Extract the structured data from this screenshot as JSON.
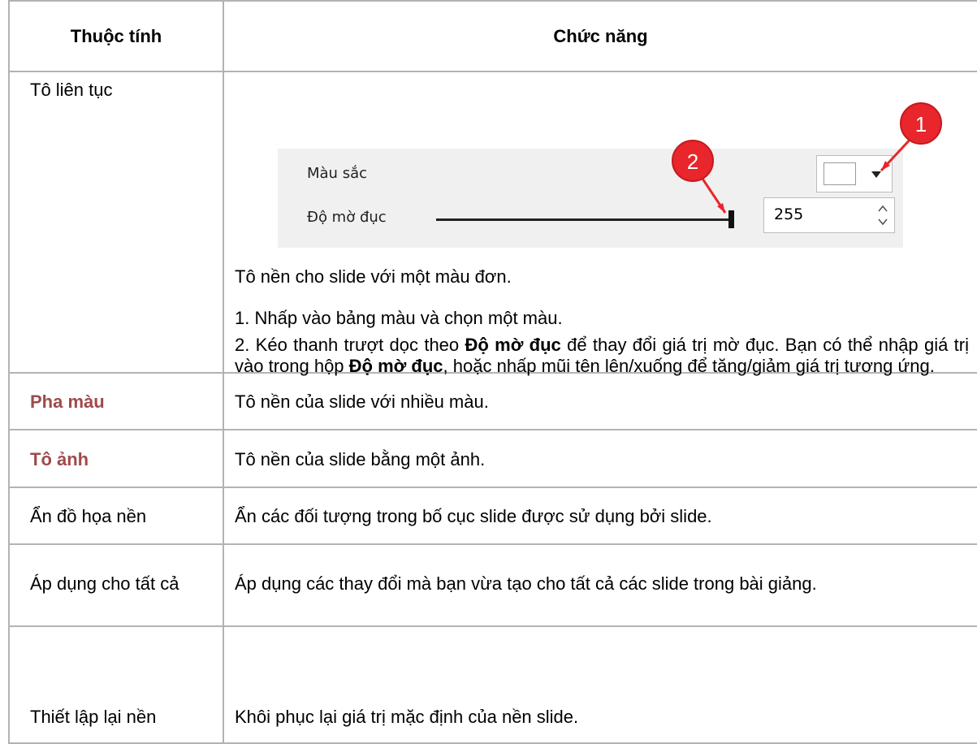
{
  "table": {
    "header": {
      "col1": "Thuộc tính",
      "col2": "Chức năng"
    },
    "rows": [
      {
        "property": "Tô liên tục",
        "panel": {
          "color_label": "Màu sắc",
          "opacity_label": "Độ mờ đục",
          "opacity_value": "255",
          "opacity_level": 1.0,
          "callouts": [
            "1",
            "2"
          ],
          "colors": {
            "callout": "#e8262b",
            "panel_bg": "#f0f0f0"
          }
        },
        "desc1": "Tô nền cho slide với một màu đơn.",
        "desc2": "1. Nhấp vào bảng màu và chọn một màu.",
        "desc3": {
          "p1": "2. Kéo thanh trượt dọc theo ",
          "b1": "Độ mờ đục",
          "p2": " để thay đổi giá trị mờ đục. Bạn có thể nhập giá trị vào trong hộp ",
          "b2": "Độ mờ đục",
          "p3": ", hoặc nhấp mũi tên lên/xuống để tăng/giảm giá trị tương ứng."
        }
      },
      {
        "property": "Pha màu",
        "function": "Tô nền của slide với nhiều màu."
      },
      {
        "property": "Tô ảnh",
        "function": "Tô nền của slide bằng một ảnh."
      },
      {
        "property": "Ẩn đồ họa nền",
        "function": "Ẩn các đối tượng trong bố cục slide được sử dụng bởi slide."
      },
      {
        "property": "Áp dụng cho tất cả",
        "function": "Áp dụng các thay đổi mà bạn vừa tạo cho tất cả các slide trong bài giảng."
      },
      {
        "property": "Thiết lập lại nền",
        "function": "Khôi phục lại giá trị mặc định của nền slide."
      }
    ],
    "link_color": "#a04a4a"
  }
}
